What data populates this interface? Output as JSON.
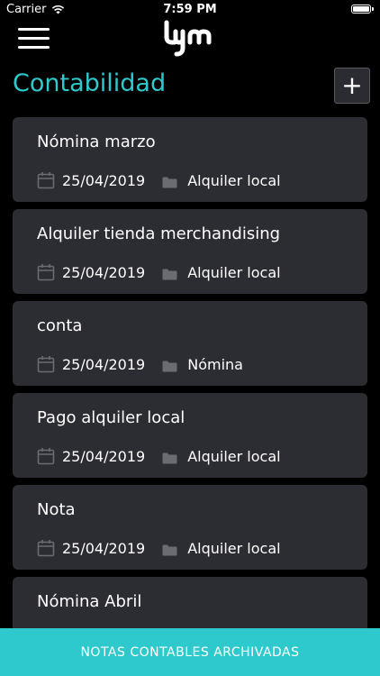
{
  "status_bar": {
    "carrier": "Carrier",
    "time": "7:59 PM",
    "battery_level": 1.0
  },
  "header": {
    "menu_icon": "hamburger-menu-icon",
    "logo_text": "lym",
    "title": "Contabilidad",
    "add_label": "+"
  },
  "icons": {
    "date": "calendar-icon",
    "category": "folder-icon"
  },
  "notes": [
    {
      "title": "Nómina marzo",
      "date": "25/04/2019",
      "category": "Alquiler local"
    },
    {
      "title": "Alquiler tienda merchandising",
      "date": "25/04/2019",
      "category": "Alquiler local"
    },
    {
      "title": "conta",
      "date": "25/04/2019",
      "category": "Nómina"
    },
    {
      "title": "Pago alquiler local",
      "date": "25/04/2019",
      "category": "Alquiler local"
    },
    {
      "title": "Nota",
      "date": "25/04/2019",
      "category": "Alquiler local"
    },
    {
      "title": "Nómina Abril",
      "date": "",
      "category": ""
    }
  ],
  "footer": {
    "archived_label": "NOTAS CONTABLES ARCHIVADAS"
  },
  "colors": {
    "accent": "#2ec9cc",
    "background": "#000000",
    "card": "#2c2c33",
    "icon": "#6b6b73"
  }
}
